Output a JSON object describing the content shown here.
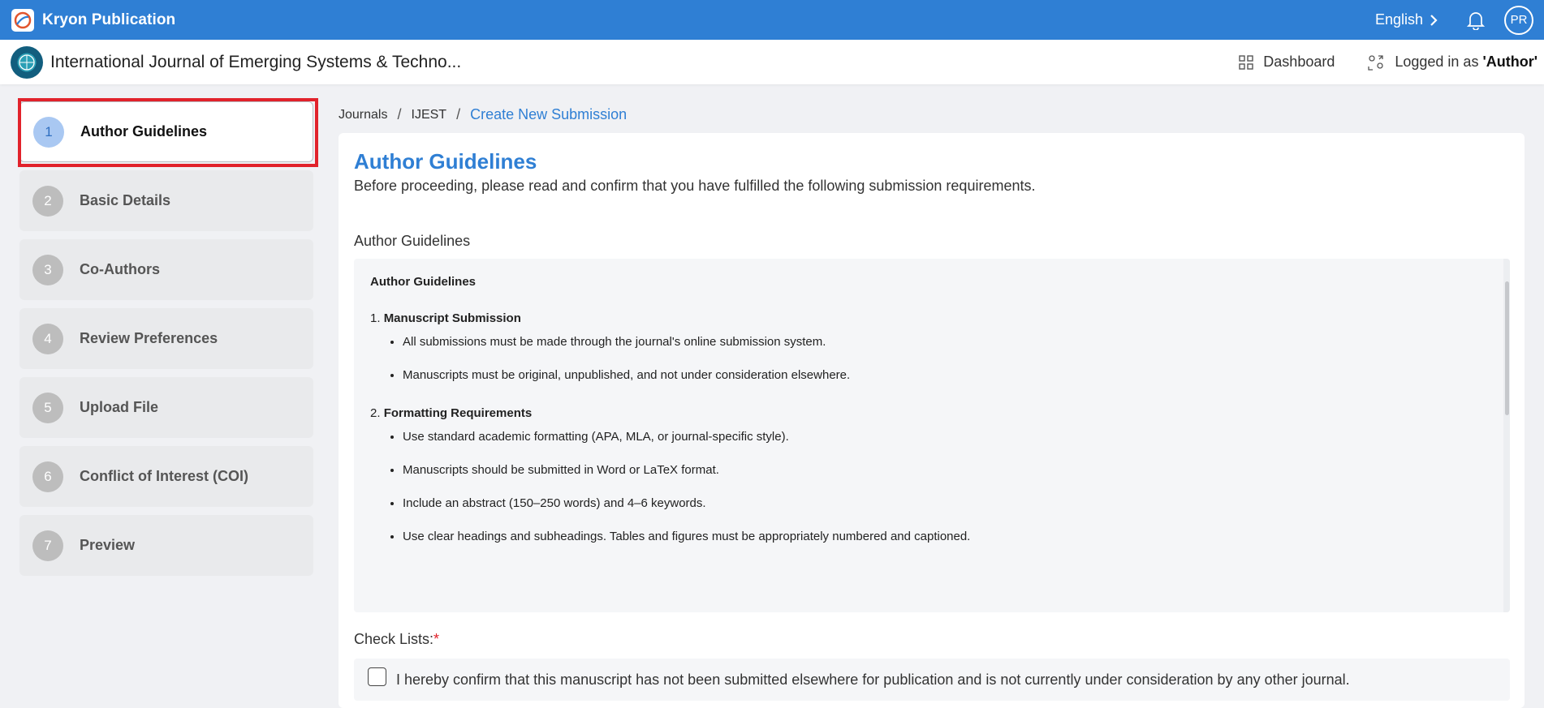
{
  "topbar": {
    "brand": "Kryon Publication",
    "language": "English",
    "avatar_initials": "PR"
  },
  "journal": {
    "title": "International Journal of Emerging Systems & Techno...",
    "dashboard_label": "Dashboard",
    "logged_in_prefix": "Logged in as ",
    "logged_in_role": "'Author'"
  },
  "steps": [
    {
      "num": "1",
      "label": "Author Guidelines",
      "active": true
    },
    {
      "num": "2",
      "label": "Basic Details"
    },
    {
      "num": "3",
      "label": "Co-Authors"
    },
    {
      "num": "4",
      "label": "Review Preferences"
    },
    {
      "num": "5",
      "label": "Upload File"
    },
    {
      "num": "6",
      "label": "Conflict of Interest (COI)"
    },
    {
      "num": "7",
      "label": "Preview"
    }
  ],
  "breadcrumb": [
    "Journals",
    "IJEST",
    "Create New Submission"
  ],
  "main": {
    "title": "Author Guidelines",
    "subtitle": "Before proceeding, please read and confirm that you have fulfilled the following submission requirements.",
    "section_label": "Author Guidelines",
    "guidelines": {
      "heading": "Author Guidelines",
      "sections": [
        {
          "num": "1.",
          "title": "Manuscript Submission",
          "items": [
            "All submissions must be made through the journal's online submission system.",
            "Manuscripts must be original, unpublished, and not under consideration elsewhere."
          ]
        },
        {
          "num": "2.",
          "title": "Formatting Requirements",
          "items": [
            "Use standard academic formatting (APA, MLA, or journal-specific style).",
            "Manuscripts should be submitted in Word or LaTeX format.",
            "Include an abstract (150–250 words) and 4–6 keywords.",
            "Use clear headings and subheadings. Tables and figures must be appropriately numbered and captioned."
          ]
        }
      ]
    },
    "checklist_label": "Check Lists:",
    "checklist_required": "*",
    "checklist_items": [
      "I hereby confirm that this manuscript has not been submitted elsewhere for publication and is not currently under consideration by any other journal."
    ]
  }
}
